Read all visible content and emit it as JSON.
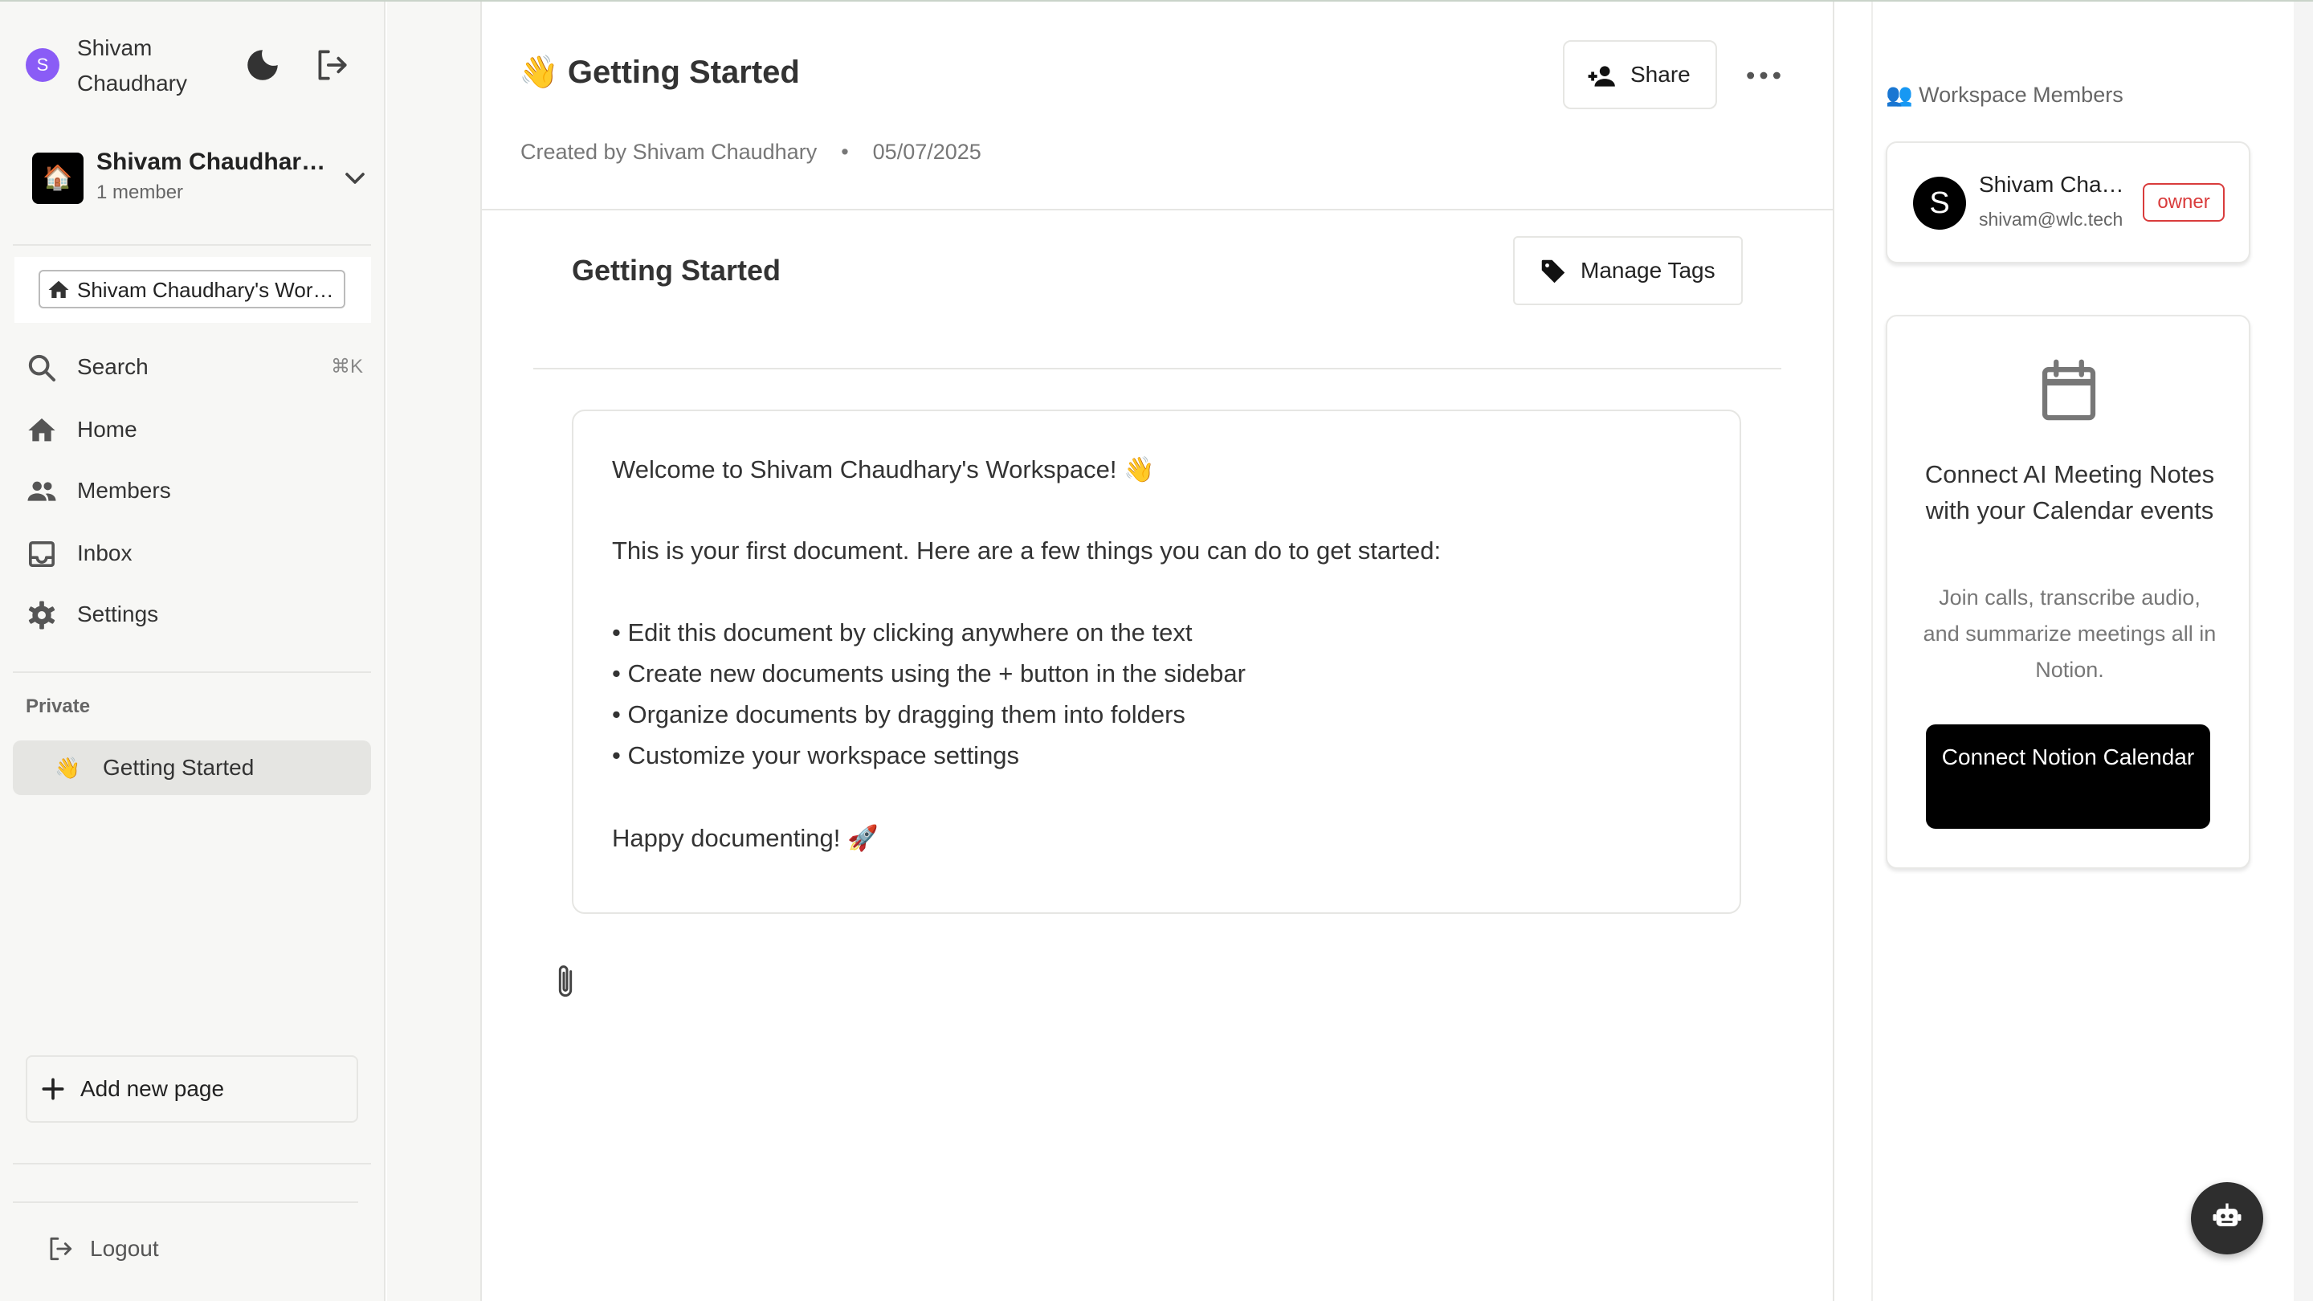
{
  "user": {
    "initial": "S",
    "name": "Shivam\nChaudhary"
  },
  "workspace": {
    "icon": "🏠",
    "name": "Shivam Chaudhary's Workspace",
    "members": "1 member"
  },
  "breadcrumb": {
    "label": "Shivam Chaudhary's Workspace"
  },
  "nav": {
    "search": "Search",
    "search_shortcut": "⌘K",
    "home": "Home",
    "members": "Members",
    "inbox": "Inbox",
    "settings": "Settings"
  },
  "private_section": {
    "label": "Private",
    "pages": [
      {
        "emoji": "👋",
        "title": "Getting Started"
      }
    ]
  },
  "add_page": "Add new page",
  "logout": "Logout",
  "doc": {
    "title": "👋 Getting Started",
    "created_by": "Created by Shivam Chaudhary",
    "separator": "•",
    "date": "05/07/2025",
    "share": "Share",
    "inner_title": "Getting Started",
    "manage_tags": "Manage Tags",
    "lines": [
      "Welcome to Shivam Chaudhary's Workspace! 👋",
      "This is your first document. Here are a few things you can do to get started:",
      "• Edit this document by clicking anywhere on the text",
      "• Create new documents using the + button in the sidebar",
      "• Organize documents by dragging them into folders",
      "• Customize your workspace settings",
      "Happy documenting! 🚀"
    ]
  },
  "right_panel": {
    "members_title": "👥 Workspace Members",
    "member": {
      "initial": "S",
      "name": "Shivam Chaudhary",
      "email": "shivam@wlc.tech",
      "role": "owner"
    },
    "calendar": {
      "title": "Connect AI Meeting Notes with your Calendar events",
      "description": "Join calls, transcribe audio, and summarize meetings all in Notion.",
      "button": "Connect Notion Calendar"
    }
  },
  "icons": {
    "theme": "moon-icon",
    "exit": "exit-icon",
    "chevron": "chevron-down-icon",
    "home": "home-icon",
    "search": "search-icon",
    "members": "people-icon",
    "inbox": "inbox-icon",
    "settings": "gear-icon",
    "add": "plus-icon",
    "share": "person-add-icon",
    "more": "more-horizontal-icon",
    "tag": "tag-icon",
    "attach": "paperclip-icon",
    "calendar": "calendar-icon",
    "bot": "bot-icon"
  },
  "colors": {
    "avatar": "#8a5cf6",
    "owner": "#d93c3c",
    "cta": "#000000"
  }
}
